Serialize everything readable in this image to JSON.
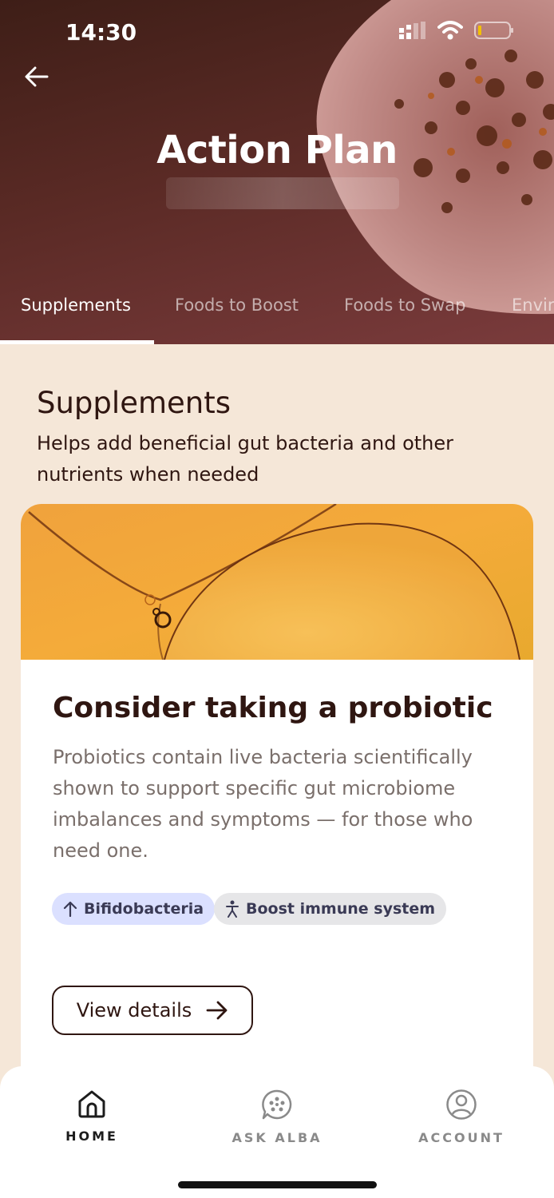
{
  "status_bar": {
    "time": "14:30"
  },
  "header": {
    "title": "Action Plan",
    "back_icon": "arrow-left-icon"
  },
  "tabs": [
    {
      "label": "Supplements",
      "active": true
    },
    {
      "label": "Foods to Boost",
      "active": false
    },
    {
      "label": "Foods to Swap",
      "active": false
    },
    {
      "label": "Envir",
      "active": false
    }
  ],
  "section": {
    "title": "Supplements",
    "description": "Helps add beneficial gut bacteria and other nutrients when needed"
  },
  "card": {
    "title": "Consider taking a probiotic",
    "body": "Probiotics contain live bacteria scientifically shown to support specific gut microbiome imbalances and symptoms — for those who need one.",
    "tags": [
      {
        "label": "Bifidobacteria",
        "icon": "arrow-up-icon"
      },
      {
        "label": "Boost immune system",
        "icon": "person-icon"
      }
    ],
    "cta_label": "View details"
  },
  "bottom_nav": [
    {
      "label": "HOME",
      "icon": "home-icon",
      "active": true
    },
    {
      "label": "ASK ALBA",
      "icon": "chat-icon",
      "active": false
    },
    {
      "label": "ACCOUNT",
      "icon": "user-icon",
      "active": false
    }
  ],
  "colors": {
    "text_dark": "#2f1611",
    "background": "#f5e7d8",
    "tag_bifido_bg": "#dbe0ff",
    "tag_immune_bg": "#e6e6e8"
  }
}
